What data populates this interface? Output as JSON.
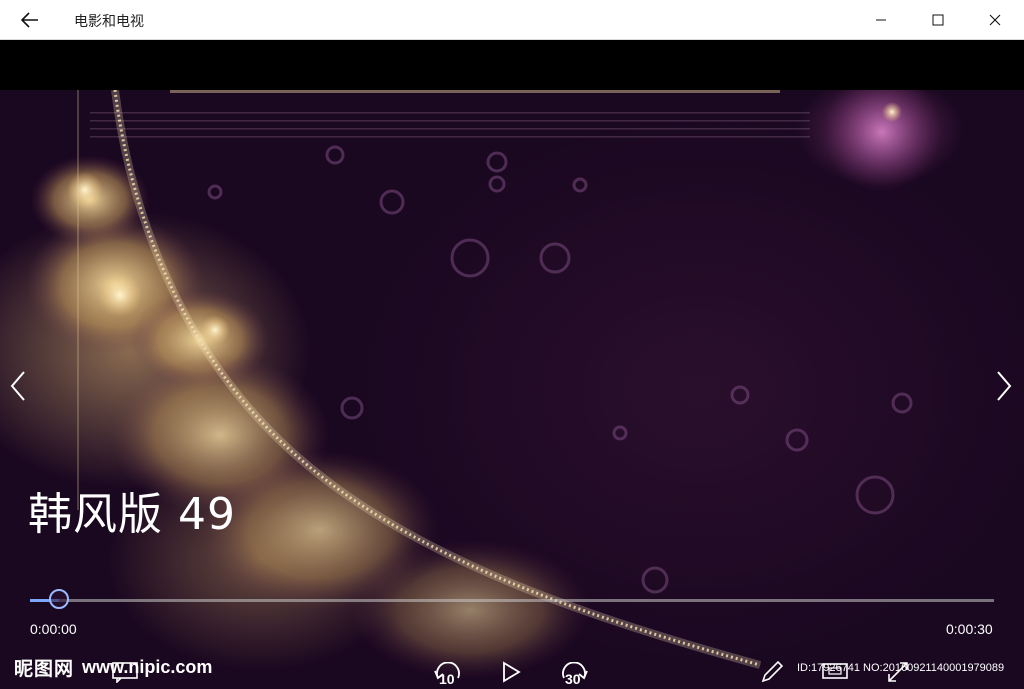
{
  "titlebar": {
    "title": "电影和电视",
    "back_icon": "back-arrow-icon",
    "minimize_icon": "minimize-icon",
    "maximize_icon": "maximize-icon",
    "close_icon": "close-icon"
  },
  "video": {
    "title": "韩风版 49",
    "prev_icon": "chevron-left-icon",
    "next_icon": "chevron-right-icon"
  },
  "seek": {
    "current_time": "0:00:00",
    "duration": "0:00:30",
    "progress": 0.03,
    "accent": "#7da6ff"
  },
  "controls": {
    "skip_back_label": "10",
    "skip_forward_label": "30",
    "icons": [
      "subtitles-icon",
      "skip-back-10-icon",
      "play-icon",
      "skip-forward-30-icon",
      "pencil-icon",
      "cast-icon",
      "fullscreen-icon"
    ]
  },
  "watermark": {
    "logo": "昵图网",
    "site": "www.nipic.com",
    "id_text": "ID:17926741 NO:20160921140001979089"
  }
}
